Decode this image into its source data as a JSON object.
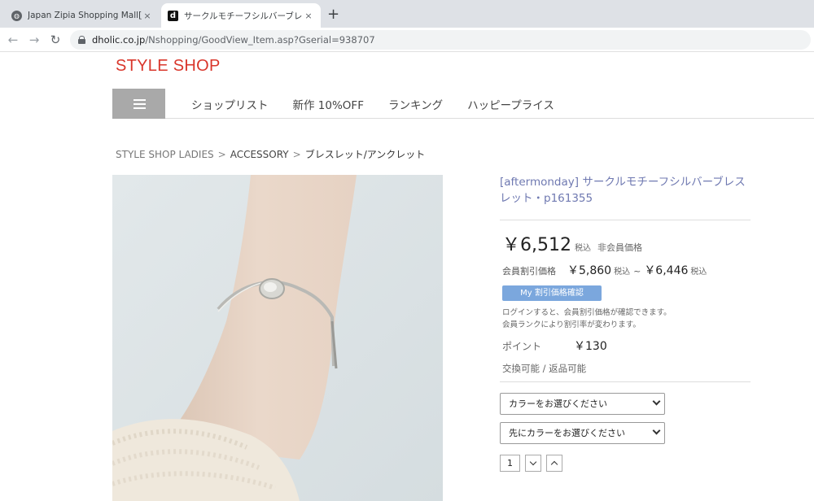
{
  "browser": {
    "tabs": [
      {
        "title": "Japan Zipia Shopping Mall[Japan",
        "icon": "globe-icon",
        "close": "×"
      },
      {
        "title": "サークルモチーフシルバーブレスレット|レ",
        "icon": "dholic-logo-icon",
        "close": "×"
      }
    ],
    "new_tab": "+",
    "url_host": "dholic.co.jp",
    "url_path": "/Nshopping/GoodView_Item.asp?Gserial=938707"
  },
  "site": {
    "logo": "STYLE SHOP",
    "nav": [
      "ショップリスト",
      "新作 10%OFF",
      "ランキング",
      "ハッピープライス"
    ],
    "breadcrumb": [
      "STYLE SHOP LADIES",
      "ACCESSORY",
      "ブレスレット/アンクレット"
    ],
    "breadcrumb_sep": ">"
  },
  "product": {
    "title": "[aftermonday] サークルモチーフシルバーブレスレット・p161355",
    "price": "￥6,512",
    "price_tax": "税込",
    "price_note": "非会員価格",
    "member_label": "会員割引価格",
    "member_low": "￥5,860",
    "member_tilde": "~",
    "member_high": "￥6,446",
    "tax_label": "税込",
    "my_discount_button": "My 割引価格確認",
    "note_line1": "ログインすると、会員割引価格が確認できます。",
    "note_line2": "会員ランクにより割引率が変わります。",
    "point_label": "ポイント",
    "point_value": "￥130",
    "exchange": "交換可能 / 返品可能",
    "color_select": "カラーをお選びください",
    "size_select": "先にカラーをお選びください",
    "quantity": "1"
  },
  "colors": {
    "logo": "#d9362b",
    "title": "#6f79b1",
    "button": "#7ba7dd",
    "menu": "#a9a9a9"
  }
}
